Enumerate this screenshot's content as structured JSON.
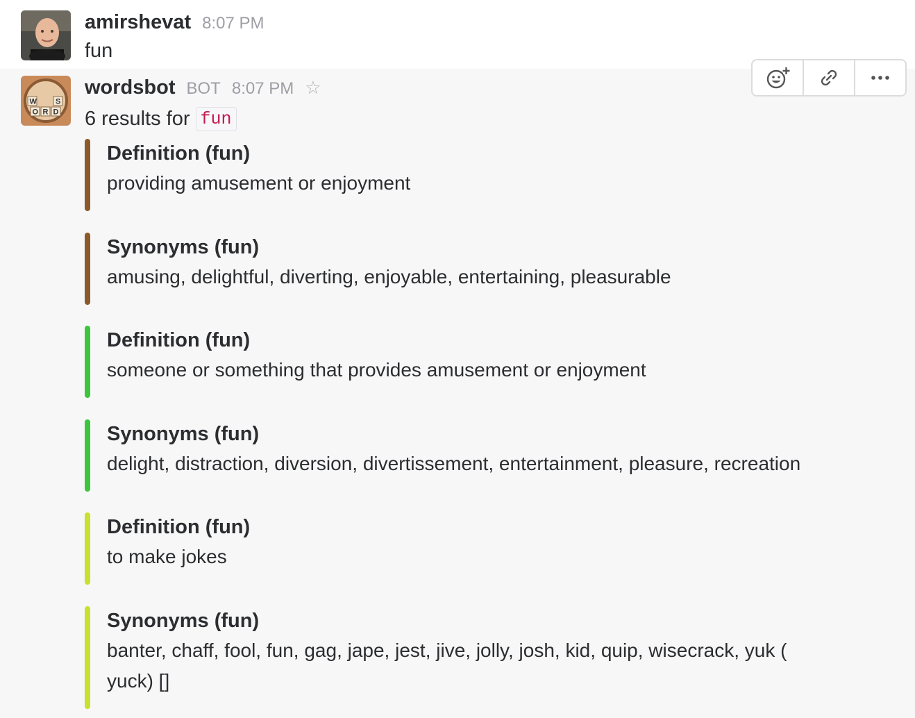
{
  "messages": [
    {
      "sender": "amirshevat",
      "time": "8:07 PM",
      "text": "fun",
      "avatar": "user-photo"
    },
    {
      "sender": "wordsbot",
      "badge": "BOT",
      "time": "8:07 PM",
      "avatar": "word-dice-logo",
      "result_prefix": "6 results for",
      "query": "fun",
      "attachments": [
        {
          "title": "Definition (fun)",
          "text": "providing amusement or enjoyment",
          "color": "#8b5a2b"
        },
        {
          "title": "Synonyms (fun)",
          "text": "amusing, delightful, diverting, enjoyable, entertaining, pleasurable",
          "color": "#8b5a2b"
        },
        {
          "title": "Definition (fun)",
          "text": "someone or something that provides amusement or enjoyment",
          "color": "#3ec53e"
        },
        {
          "title": "Synonyms (fun)",
          "text": "delight, distraction, diversion, divertissement, entertainment, pleasure, recreation",
          "color": "#3ec53e"
        },
        {
          "title": "Definition (fun)",
          "text": "to make jokes",
          "color": "#c8e02e"
        },
        {
          "title": "Synonyms (fun)",
          "text": "banter, chaff, fool, fun, gag, jape, jest, jive, jolly, josh, kid, quip, wisecrack, yuk (",
          "text2": "yuck) []",
          "color": "#c8e02e"
        }
      ]
    }
  ],
  "hover_actions": [
    "add-reaction-icon",
    "copy-link-icon",
    "more-actions-icon"
  ],
  "logo_letters": [
    "W",
    "S",
    "O",
    "R",
    "D"
  ]
}
